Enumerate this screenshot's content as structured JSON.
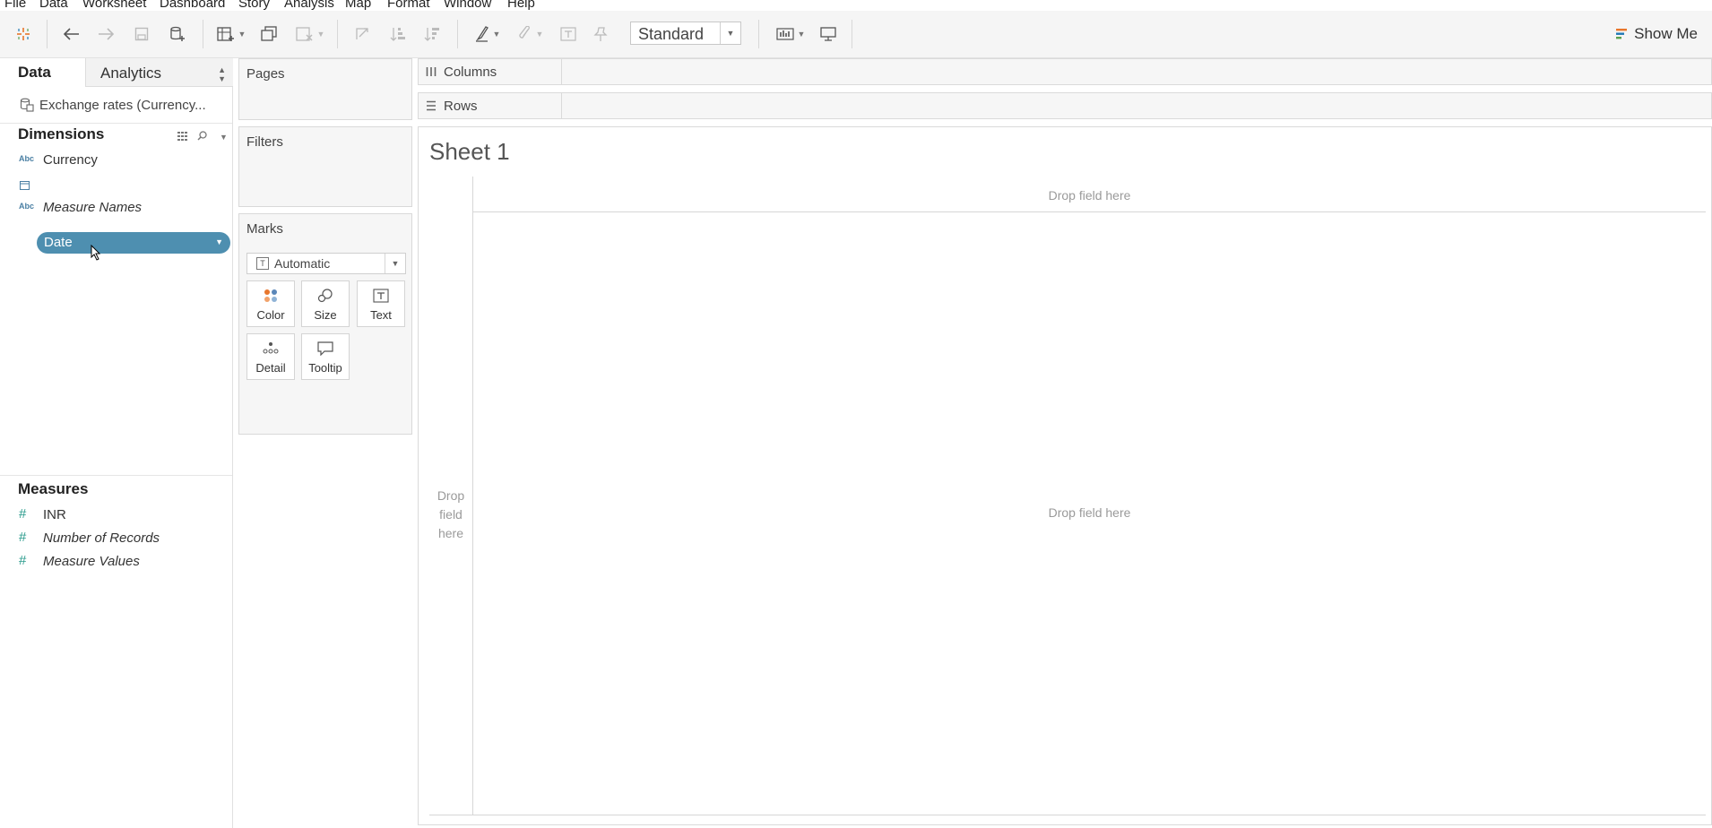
{
  "menu": [
    "File",
    "Data",
    "Worksheet",
    "Dashboard",
    "Story",
    "Analysis",
    "Map",
    "Format",
    "Window",
    "Help"
  ],
  "toolbar": {
    "fit_value": "Standard",
    "show_me_label": "Show Me"
  },
  "data_pane": {
    "tab_data": "Data",
    "tab_analytics": "Analytics",
    "datasource": "Exchange rates (Currency...",
    "dimensions_heading": "Dimensions",
    "dimensions": [
      {
        "type": "Abc",
        "label": "Currency"
      },
      {
        "type": "date",
        "label": "Date"
      },
      {
        "type": "Abc",
        "label": "Measure Names"
      }
    ],
    "measures_heading": "Measures",
    "measures": [
      {
        "type": "#",
        "label": "INR"
      },
      {
        "type": "#",
        "label": "Number of Records"
      },
      {
        "type": "#",
        "label": "Measure Values"
      }
    ]
  },
  "cards": {
    "pages": "Pages",
    "filters": "Filters",
    "marks": "Marks",
    "mark_type": "Automatic",
    "buttons": {
      "color": "Color",
      "size": "Size",
      "text": "Text",
      "detail": "Detail",
      "tooltip": "Tooltip"
    }
  },
  "shelves": {
    "columns": "Columns",
    "rows": "Rows"
  },
  "view": {
    "title": "Sheet 1",
    "drop_top": "Drop field here",
    "drop_left": "Drop field here",
    "drop_center": "Drop field here"
  }
}
